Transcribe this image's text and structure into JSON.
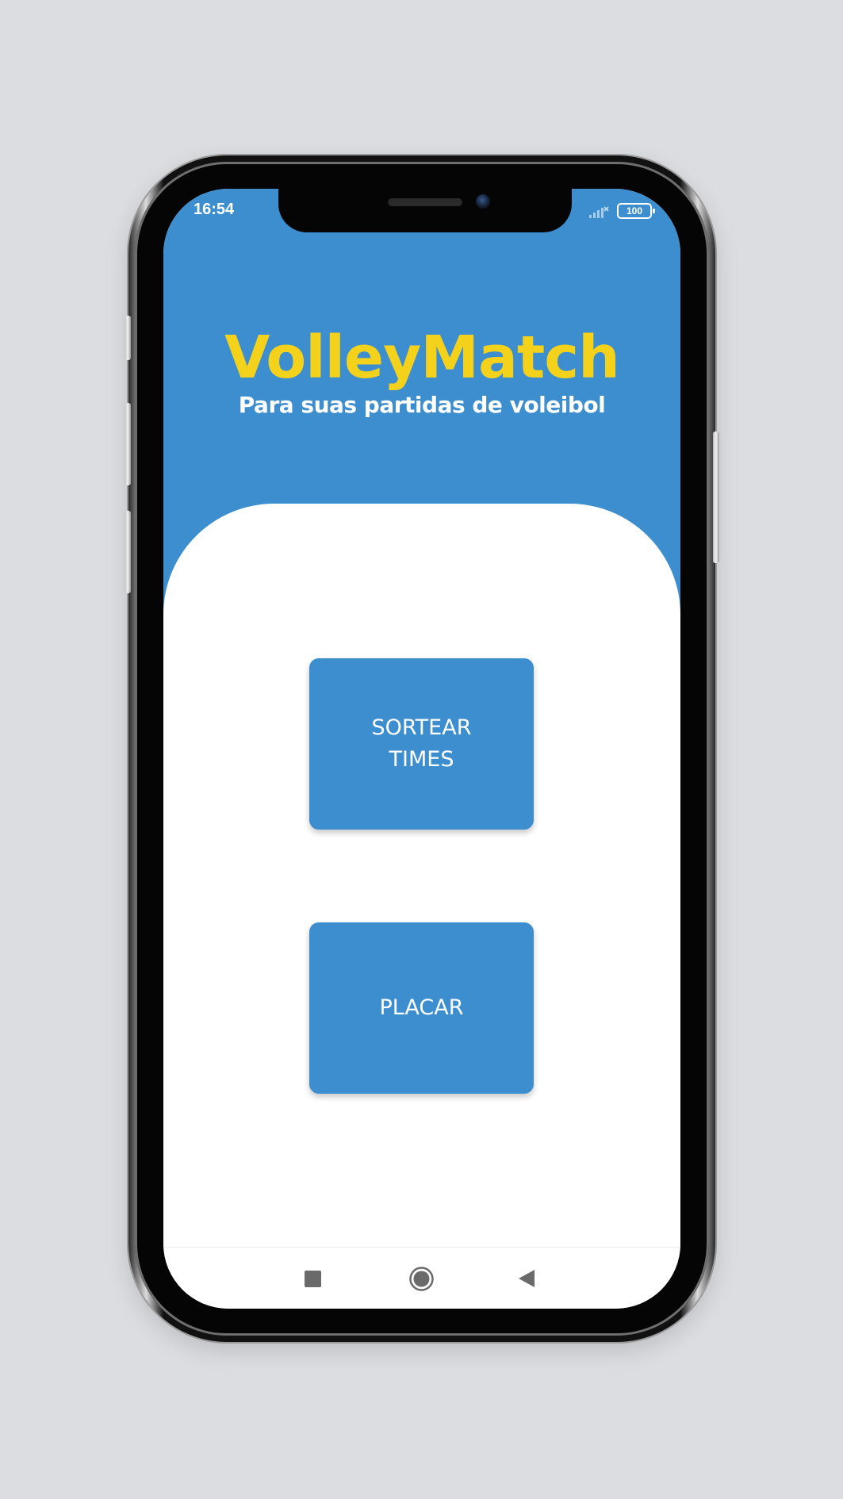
{
  "status_bar": {
    "time": "16:54",
    "battery": "100",
    "signal_icon": "signal-weak-icon",
    "battery_icon": "battery-icon"
  },
  "header": {
    "title": "VolleyMatch",
    "subtitle": "Para suas partidas de voleibol"
  },
  "actions": {
    "sortear_label": "SORTEAR TIMES",
    "placar_label": "PLACAR"
  },
  "nav_bar": {
    "recents_icon": "square-icon",
    "home_icon": "circle-home-icon",
    "back_icon": "triangle-back-icon"
  },
  "colors": {
    "primary": "#3d8ecf",
    "title": "#f4d21c",
    "background": "#dcdde1"
  }
}
